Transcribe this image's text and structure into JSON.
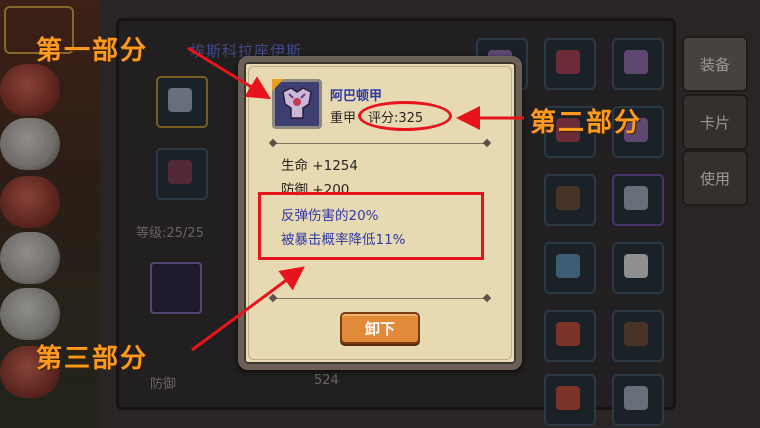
{
  "hero_panel": {
    "hero_name": "埃斯科拉座伊斯",
    "level_text": "等级:25/25",
    "defense_label": "防御",
    "defense_value": "524"
  },
  "right_tabs": [
    "装备",
    "卡片",
    "使用"
  ],
  "tooltip": {
    "item_name": "阿巴顿甲",
    "item_type": "重甲",
    "score_text": "评分:325",
    "stats": [
      "生命 +1254",
      "防御 +200"
    ],
    "effects": [
      "反弹伤害的20%",
      "被暴击概率降低11%"
    ],
    "unequip_label": "卸下"
  },
  "annotations": {
    "part1": "第一部分",
    "part2": "第二部分",
    "part3": "第三部分"
  },
  "colors": {
    "annotation": "#ff9a1c",
    "highlight": "#e8141c",
    "effect_text": "#2f3aa6",
    "button": "#e08a3a"
  }
}
